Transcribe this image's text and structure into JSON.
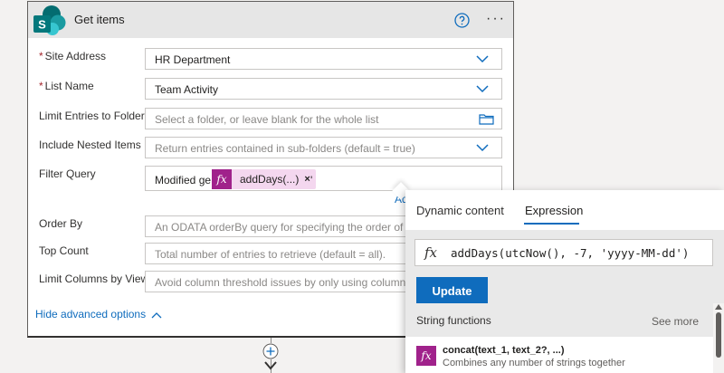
{
  "card": {
    "title": "Get items",
    "help_icon": "help-circle-icon",
    "more_icon": "more-horizontal-icon",
    "more_label": "···",
    "logo_letter": "S"
  },
  "fields": [
    {
      "label": "Site Address",
      "required": true,
      "value": "HR Department",
      "placeholder": "",
      "control": "dropdown"
    },
    {
      "label": "List Name",
      "required": true,
      "value": "Team Activity",
      "placeholder": "",
      "control": "dropdown"
    },
    {
      "label": "Limit Entries to Folder",
      "required": false,
      "value": "",
      "placeholder": "Select a folder, or leave blank for the whole list",
      "control": "folder"
    },
    {
      "label": "Include Nested Items",
      "required": false,
      "value": "",
      "placeholder": "Return entries contained in sub-folders (default = true)",
      "control": "dropdown"
    },
    {
      "label": "Filter Query",
      "required": false,
      "value": "Modified ge '",
      "token": {
        "icon": "fx",
        "text": "addDays(...)",
        "close": "×"
      },
      "suffix": "'"
    },
    {
      "label": "Order By",
      "required": false,
      "value": "",
      "placeholder": "An ODATA orderBy query for specifying the order of entries."
    },
    {
      "label": "Top Count",
      "required": false,
      "value": "",
      "placeholder": "Total number of entries to retrieve (default = all)."
    },
    {
      "label": "Limit Columns by View",
      "required": false,
      "value": "",
      "placeholder": "Avoid column threshold issues by only using columns defined in a view."
    }
  ],
  "add_link": "Ad",
  "required_mark": "*",
  "hide_advanced": "Hide advanced options",
  "flyout": {
    "tabs": [
      "Dynamic content",
      "Expression"
    ],
    "active_tab": "Expression",
    "fx_symbol": "fx",
    "expression": "addDays(utcNow(), -7, 'yyyy-MM-dd')",
    "update_label": "Update",
    "section_title": "String functions",
    "see_more": "See more",
    "functions": [
      {
        "name": "concat(text_1, text_2?, ...)",
        "description": "Combines any number of strings together"
      }
    ]
  },
  "colors": {
    "accent": "#0f6cbd",
    "fx_token": "#a0228b",
    "token_bg": "#f4d7ef",
    "required": "#a4262c"
  }
}
